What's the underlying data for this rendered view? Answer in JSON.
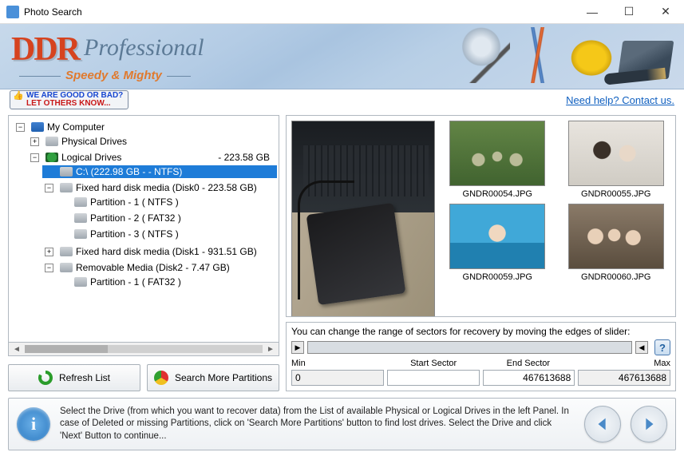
{
  "window": {
    "title": "Photo Search"
  },
  "banner": {
    "logo_main": "DDR",
    "logo_sub": "Professional",
    "tagline": "Speedy & Mighty"
  },
  "subbar": {
    "feedback_l1": "WE ARE GOOD OR BAD?",
    "feedback_l2": "LET OTHERS KNOW...",
    "help_link": "Need help? Contact us."
  },
  "tree": {
    "root": "My Computer",
    "physical": "Physical Drives",
    "logical": "Logical Drives",
    "logical_size": "- 223.58 GB",
    "selected": "C:\\ (222.98 GB -  - NTFS)",
    "fixed0": "Fixed hard disk media (Disk0 - 223.58 GB)",
    "p01": "Partition - 1 ( NTFS )",
    "p02": "Partition - 2 ( FAT32 )",
    "p03": "Partition - 3 ( NTFS )",
    "fixed1": "Fixed hard disk media (Disk1 - 931.51 GB)",
    "rem2": "Removable Media (Disk2 - 7.47 GB)",
    "p21": "Partition - 1 ( FAT32 )"
  },
  "buttons": {
    "refresh": "Refresh List",
    "search_more": "Search More Partitions"
  },
  "thumbs": {
    "n1": "GNDR00054.JPG",
    "n2": "GNDR00055.JPG",
    "n3": "GNDR00059.JPG",
    "n4": "GNDR00060.JPG"
  },
  "sector": {
    "desc": "You can change the range of sectors for recovery by moving the edges of slider:",
    "lbl_min": "Min",
    "lbl_start": "Start Sector",
    "lbl_end": "End Sector",
    "lbl_max": "Max",
    "min": "0",
    "start": "",
    "end": "467613688",
    "max": "467613688"
  },
  "footer": {
    "text": "Select the Drive (from which you want to recover data) from the List of available Physical or Logical Drives in the left Panel. In case of Deleted or missing Partitions, click on 'Search More Partitions' button to find lost drives. Select the Drive and click 'Next' Button to continue..."
  }
}
